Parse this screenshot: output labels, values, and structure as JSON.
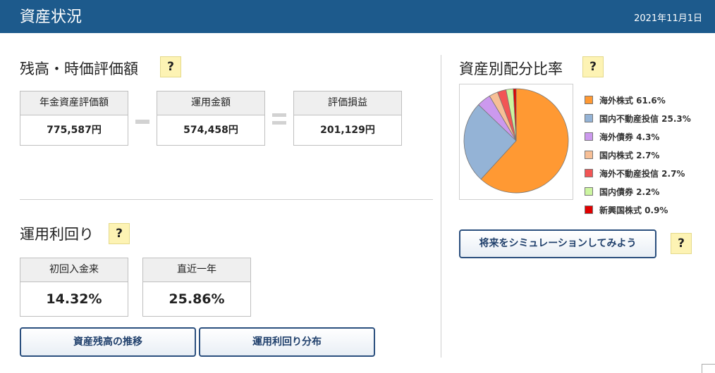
{
  "header": {
    "title": "資産状況",
    "date": "2021年11月1日"
  },
  "help_label": "?",
  "balance": {
    "title": "残高・時価評価額",
    "cards": [
      {
        "label": "年金資産評価額",
        "value": "775,587円"
      },
      {
        "label": "運用金額",
        "value": "574,458円"
      },
      {
        "label": "評価損益",
        "value": "201,129円"
      }
    ]
  },
  "yield": {
    "title": "運用利回り",
    "cards": [
      {
        "label": "初回入金来",
        "value": "14.32%"
      },
      {
        "label": "直近一年",
        "value": "25.86%"
      }
    ]
  },
  "buttons": {
    "balance_history": "資産残高の推移",
    "yield_distribution": "運用利回り分布",
    "simulate": "将来をシミュレーションしてみよう"
  },
  "allocation": {
    "title": "資産別配分比率"
  },
  "chart_data": {
    "type": "pie",
    "categories": [
      "海外株式",
      "国内不動産投信",
      "海外債券",
      "国内株式",
      "海外不動産投信",
      "国内債券",
      "新興国株式"
    ],
    "values": [
      61.6,
      25.3,
      4.3,
      2.7,
      2.7,
      2.2,
      0.9
    ],
    "labels": [
      "海外株式 61.6%",
      "国内不動産投信 25.3%",
      "海外債券 4.3%",
      "国内株式 2.7%",
      "海外不動産投信 2.7%",
      "国内債券 2.2%",
      "新興国株式 0.9%"
    ],
    "colors": [
      "#ff9933",
      "#94b3d6",
      "#cc99ee",
      "#f7bf96",
      "#f25555",
      "#ccf5a0",
      "#e00000"
    ],
    "legend": "right"
  }
}
